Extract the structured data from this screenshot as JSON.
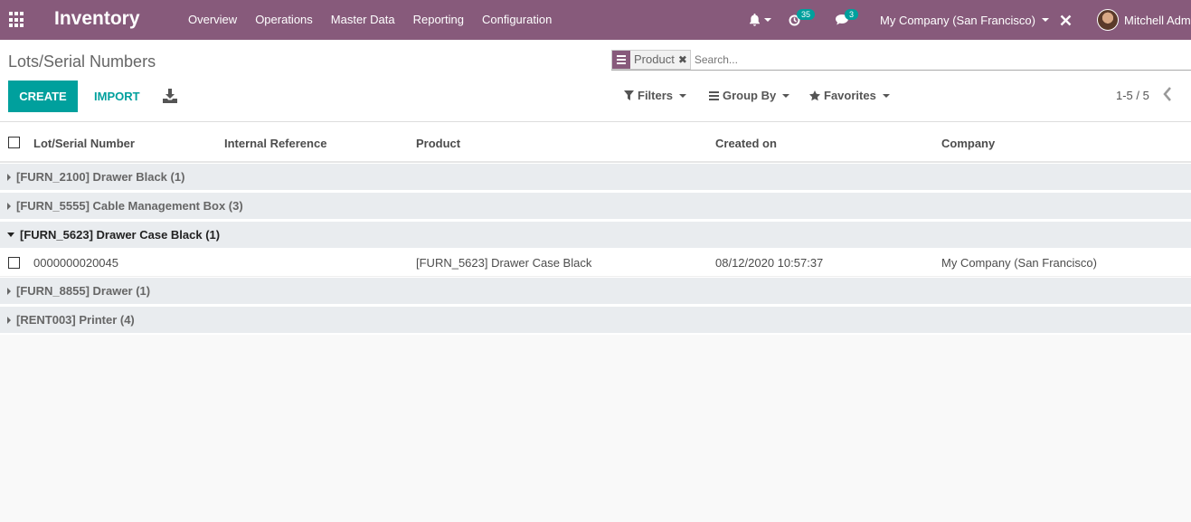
{
  "navbar": {
    "app_title": "Inventory",
    "menu": [
      "Overview",
      "Operations",
      "Master Data",
      "Reporting",
      "Configuration"
    ],
    "activities_count": "35",
    "messages_count": "3",
    "company": "My Company (San Francisco)",
    "user_name": "Mitchell Adm"
  },
  "control": {
    "breadcrumb": "Lots/Serial Numbers",
    "facet_label": "Product",
    "search_placeholder": "Search...",
    "create_label": "CREATE",
    "import_label": "IMPORT",
    "filters_label": "Filters",
    "groupby_label": "Group By",
    "favorites_label": "Favorites",
    "pager": "1-5 / 5"
  },
  "table": {
    "columns": [
      "Lot/Serial Number",
      "Internal Reference",
      "Product",
      "Created on",
      "Company"
    ],
    "groups": [
      {
        "label": "[FURN_2100] Drawer Black (1)",
        "open": false
      },
      {
        "label": "[FURN_5555] Cable Management Box (3)",
        "open": false
      },
      {
        "label": "[FURN_5623] Drawer Case Black (1)",
        "open": true
      },
      {
        "label": "[FURN_8855] Drawer (1)",
        "open": false
      },
      {
        "label": "[RENT003] Printer (4)",
        "open": false
      }
    ],
    "record": {
      "lot": "0000000020045",
      "internal_ref": "",
      "product": "[FURN_5623] Drawer Case Black",
      "created_on": "08/12/2020 10:57:37",
      "company": "My Company (San Francisco)"
    }
  },
  "colors": {
    "navbar": "#875a7b",
    "primary": "#00a09d"
  }
}
